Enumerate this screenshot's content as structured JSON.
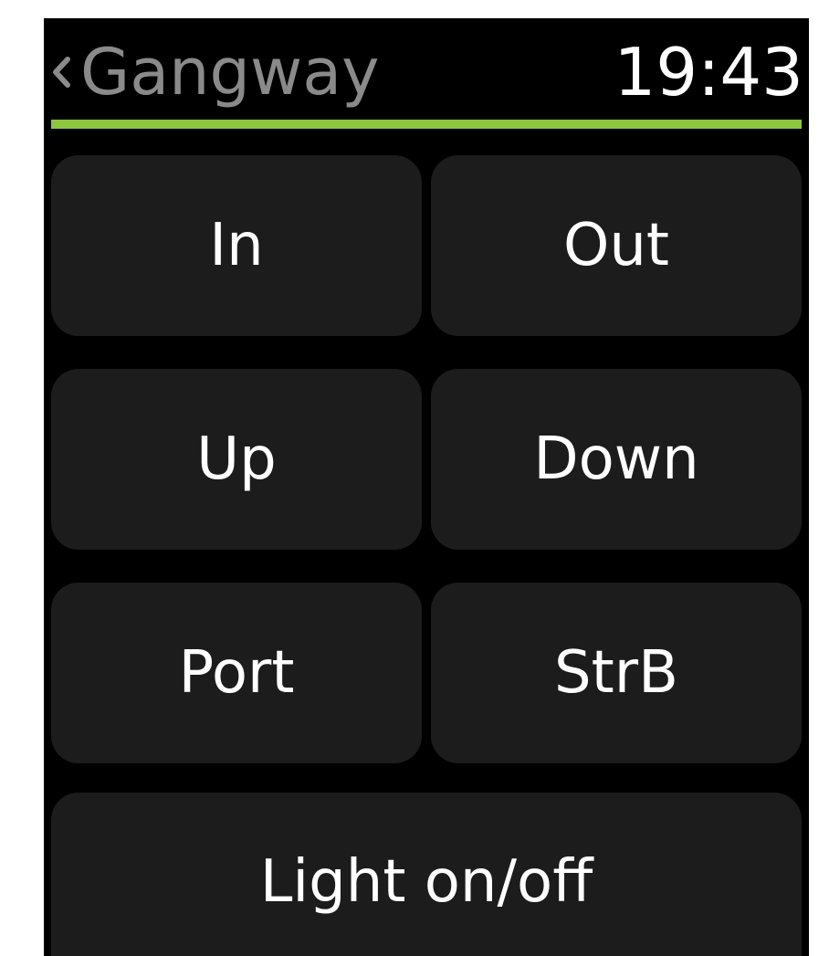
{
  "header": {
    "back_icon": "chevron-left-icon",
    "title": "Gangway",
    "time": "19:43"
  },
  "colors": {
    "background": "#000000",
    "button": "#1c1c1c",
    "accent": "#8dc63f",
    "title_text": "#8a8a8a",
    "button_text": "#ffffff"
  },
  "controls": {
    "in": "In",
    "out": "Out",
    "up": "Up",
    "down": "Down",
    "port": "Port",
    "starboard": "StrB",
    "light": "Light on/off"
  }
}
